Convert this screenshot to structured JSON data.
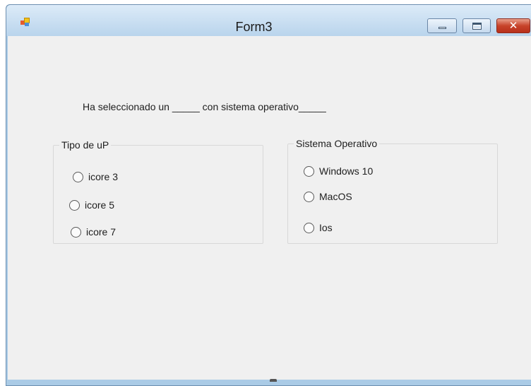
{
  "window": {
    "title": "Form3",
    "controls": {
      "minimize": "minimize",
      "maximize": "maximize",
      "close": "✕"
    }
  },
  "message": "Ha seleccionado un _____ con sistema operativo_____",
  "group_processor": {
    "legend": "Tipo de uP",
    "options": [
      "icore 3",
      "icore 5",
      "icore 7"
    ]
  },
  "group_os": {
    "legend": "Sistema Operativo",
    "options": [
      "Windows 10",
      "MacOS",
      "Ios"
    ]
  },
  "colors": {
    "titlebar": "#b9d4ec",
    "client": "#f0f0f0",
    "close": "#c7432a"
  },
  "icons": [
    "app-icon",
    "minimize-icon",
    "maximize-icon",
    "close-icon"
  ]
}
